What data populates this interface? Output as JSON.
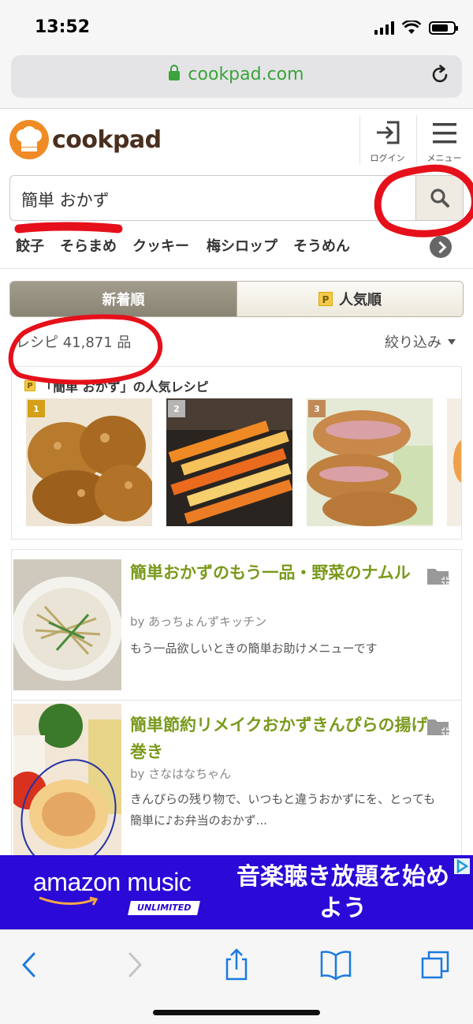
{
  "status_bar": {
    "time": "13:52"
  },
  "browser": {
    "url": "cookpad.com"
  },
  "header": {
    "logo_text": "cookpad",
    "login_label": "ログイン",
    "menu_label": "メニュー"
  },
  "search": {
    "query": "簡単 おかず"
  },
  "keywords": [
    "餃子",
    "そらまめ",
    "クッキー",
    "梅シロップ",
    "そうめん"
  ],
  "sort_tabs": {
    "new": "新着順",
    "popular": "人気順",
    "popular_badge": "P"
  },
  "results": {
    "count": "レシピ 41,871 品",
    "filter": "絞り込み"
  },
  "popular": {
    "badge": "P",
    "title": "「簡単 おかず」の人気レシピ",
    "ranks": [
      "1",
      "2",
      "3"
    ]
  },
  "recipes": [
    {
      "title": "簡単おかずのもう一品・野菜のナムル",
      "author": "by あっちょんずキッチン",
      "description": "もう一品欲しいときの簡単お助けメニューです"
    },
    {
      "title": "簡単節約リメイクおかずきんぴらの揚げ巻き",
      "author": "by さなはなちゃん",
      "description": "きんぴらの残り物で、いつもと違うおかずにを、とっても簡単に♪お弁当のおかず..."
    }
  ],
  "ad": {
    "brand": "amazon music",
    "tier": "UNLIMITED",
    "copy": "音楽聴き放題を始めよう"
  },
  "colors": {
    "brand_orange": "#f08a24",
    "recipe_title_green": "#7a9a1c",
    "secure_green": "#3ba33b",
    "ad_blue": "#2b09d6",
    "annotation_red": "#e5101a"
  }
}
